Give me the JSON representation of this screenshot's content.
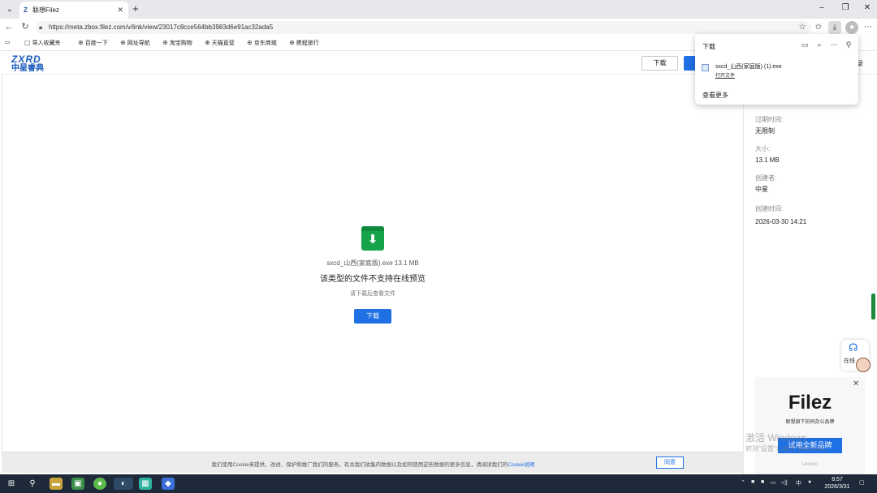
{
  "browser": {
    "tab_title": "联想Filez",
    "tab_favicon": "Z",
    "url": "https://meta.zbox.filez.com/v/link/view/23017c8cce564bb3983d6e91ac32ada5",
    "favorites": [
      {
        "label": "导入收藏夹"
      },
      {
        "label": "百度一下"
      },
      {
        "label": "网址导航"
      },
      {
        "label": "淘宝购物"
      },
      {
        "label": "天猫直营"
      },
      {
        "label": "京东商城"
      },
      {
        "label": "携程旅行"
      }
    ]
  },
  "download_panel": {
    "title": "下载",
    "file_name": "sxcd_山西(家庭版) (1).exe",
    "open_file": "打开文件",
    "see_more": "查看更多"
  },
  "site": {
    "logo_top": "ZXRD",
    "logo_bottom": "中星睿典",
    "download_top": "下载",
    "login_partial": "录"
  },
  "preview": {
    "file_line": "sxcd_山西(家庭版).exe  13.1 MB",
    "message": "该类型的文件不支持在线预览",
    "hint": "请下载后查看文件",
    "download_button": "下载"
  },
  "file_info": [
    {
      "key": "过期时间:",
      "value": "无限制"
    },
    {
      "key": "大小:",
      "value": "13.1 MB"
    },
    {
      "key": "创建者:",
      "value": "中星"
    },
    {
      "key": "创建时间:",
      "value": "2026-03-30 14:21"
    }
  ],
  "support": {
    "label": "在线"
  },
  "ad": {
    "brand": "Filez",
    "slogan": "联想旗下协同办公品牌",
    "cta": "试用全新品牌",
    "footer": "Lenovo"
  },
  "watermark": {
    "line1": "激活 Windows",
    "line2": "转到\"设置\"以激活 Windows。"
  },
  "cookie": {
    "text": "我们使用Cookie来提供、改进、保护和推广我们的服务。有关我们收集的数据以及如何使用这些数据的更多信息，请阅读我们的",
    "link": "Cookie说明",
    "agree": "同意"
  },
  "taskbar": {
    "time": "8:57",
    "date": "2026/3/31",
    "ime": "中"
  },
  "colors": {
    "accent": "#1f6fe5",
    "file_icon": "#17a34a"
  }
}
